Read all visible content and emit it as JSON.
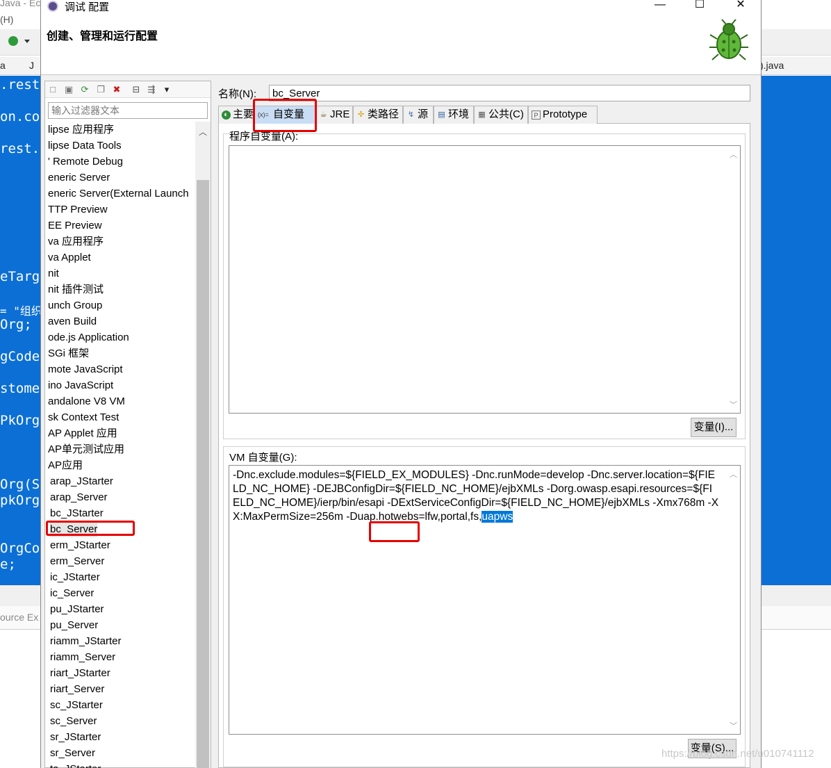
{
  "background_window": {
    "title": "Java - Ec",
    "menu": "(H)",
    "tabs": [
      "a",
      "J",
      ").java"
    ],
    "code_lines": [
      ".rest.",
      "on.con",
      "rest.b",
      "eTarge",
      "= \"组织F",
      "Org;",
      "gCode;",
      "stomer",
      "PkOrg(",
      "Org(St",
      "pkOrg;",
      "OrgCod",
      "e;"
    ],
    "bottom_label": "ource Ex"
  },
  "dialog": {
    "title": "调试 配置",
    "window_buttons": {
      "minimize": "—",
      "maximize": "☐",
      "close": "✕"
    },
    "banner_title": "创建、管理和运行配置",
    "left": {
      "filter_placeholder": "输入过滤器文本",
      "items": [
        "lipse 应用程序",
        "lipse Data Tools",
        "' Remote Debug",
        "eneric Server",
        "eneric Server(External Launch",
        "TTP Preview",
        "EE Preview",
        "va 应用程序",
        "va Applet",
        "nit",
        "nit 插件测试",
        "unch Group",
        "aven Build",
        "ode.js Application",
        "SGi 框架",
        "mote JavaScript",
        "ino JavaScript",
        "andalone V8 VM",
        "sk Context Test",
        "AP Applet 应用",
        "AP单元测试应用",
        "AP应用",
        "arap_JStarter",
        "arap_Server",
        "bc_JStarter",
        "bc_Server",
        "erm_JStarter",
        "erm_Server",
        "ic_JStarter",
        "ic_Server",
        "pu_JStarter",
        "pu_Server",
        "riamm_JStarter",
        "riamm_Server",
        "riart_JStarter",
        "riart_Server",
        "sc_JStarter",
        "sc_Server",
        "sr_JStarter",
        "sr_Server",
        "ta_JStarter"
      ],
      "selected_item": "bc_Server"
    },
    "right": {
      "name_label": "名称(N):",
      "name_value": "bc_Server",
      "tabs": [
        {
          "label": "主要",
          "icon": "main-tab-icon"
        },
        {
          "label": "自变量",
          "icon": "arguments-tab-icon"
        },
        {
          "label": "JRE",
          "icon": "jre-tab-icon"
        },
        {
          "label": "类路径",
          "icon": "classpath-tab-icon"
        },
        {
          "label": "源",
          "icon": "source-tab-icon"
        },
        {
          "label": "环境",
          "icon": "environment-tab-icon"
        },
        {
          "label": "公共(C)",
          "icon": "common-tab-icon"
        },
        {
          "label": "Prototype",
          "icon": "prototype-tab-icon"
        }
      ],
      "active_tab": "自变量",
      "program_args_label": "程序自变量(A):",
      "program_args_value": "",
      "program_vars_button": "变量(I)...",
      "vm_args_label": "VM 自变量(G):",
      "vm_args_value": "-Dnc.exclude.modules=${FIELD_EX_MODULES} -Dnc.runMode=develop -Dnc.server.location=${FIELD_NC_HOME} -DEJBConfigDir=${FIELD_NC_HOME}/ejbXMLs -Dorg.owasp.esapi.resources=${FIELD_NC_HOME}/ierp/bin/esapi -DExtServiceConfigDir=${FIELD_NC_HOME}/ejbXMLs -Xmx768m -XX:MaxPermSize=256m -Duap.hotwebs=lfw,portal,fs,",
      "vm_args_selected": "uapws",
      "vm_vars_button": "变量(S)..."
    },
    "watermark": "https://blog.csdn.net/u010741112"
  },
  "colors": {
    "code_background": "#0b6fd6",
    "active_tab": "#c9def5",
    "selection": "#0078d7",
    "highlight_box": "#e60000"
  }
}
